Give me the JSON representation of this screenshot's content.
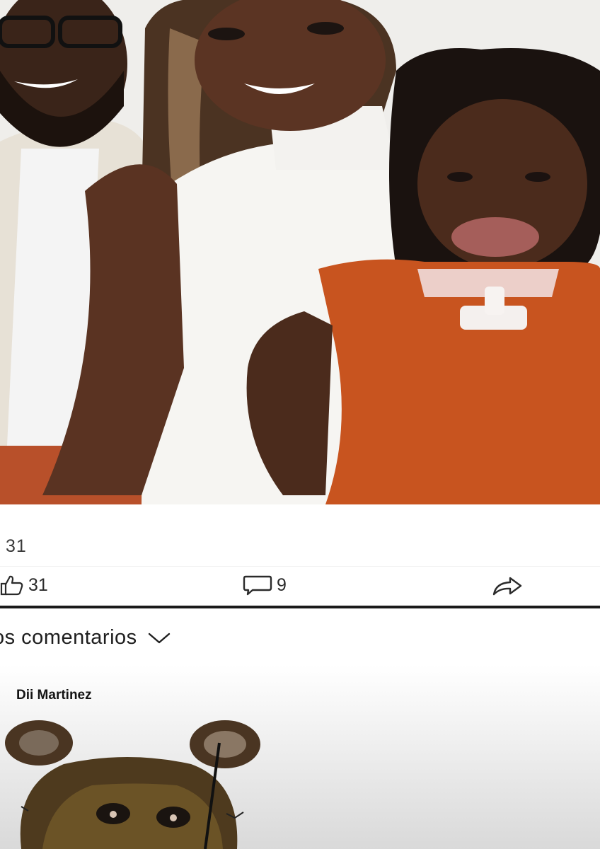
{
  "post": {
    "image_icon": "family-photo",
    "reactions_count": "31",
    "actions": {
      "like_icon": "thumbs-up-icon",
      "like_count": "31",
      "comment_icon": "comment-bubble-icon",
      "comment_count": "9",
      "share_icon": "share-arrow-icon"
    }
  },
  "comments": {
    "header_label": "os comentarios",
    "header_icon": "chevron-down-icon",
    "items": [
      {
        "author": "Dii Martinez",
        "sticker_icon": "bear-sticker"
      }
    ]
  },
  "colors": {
    "dress": "#c8541f",
    "background": "#ffffff",
    "divider": "#1a1a1a",
    "text": "#2b2b2b"
  }
}
